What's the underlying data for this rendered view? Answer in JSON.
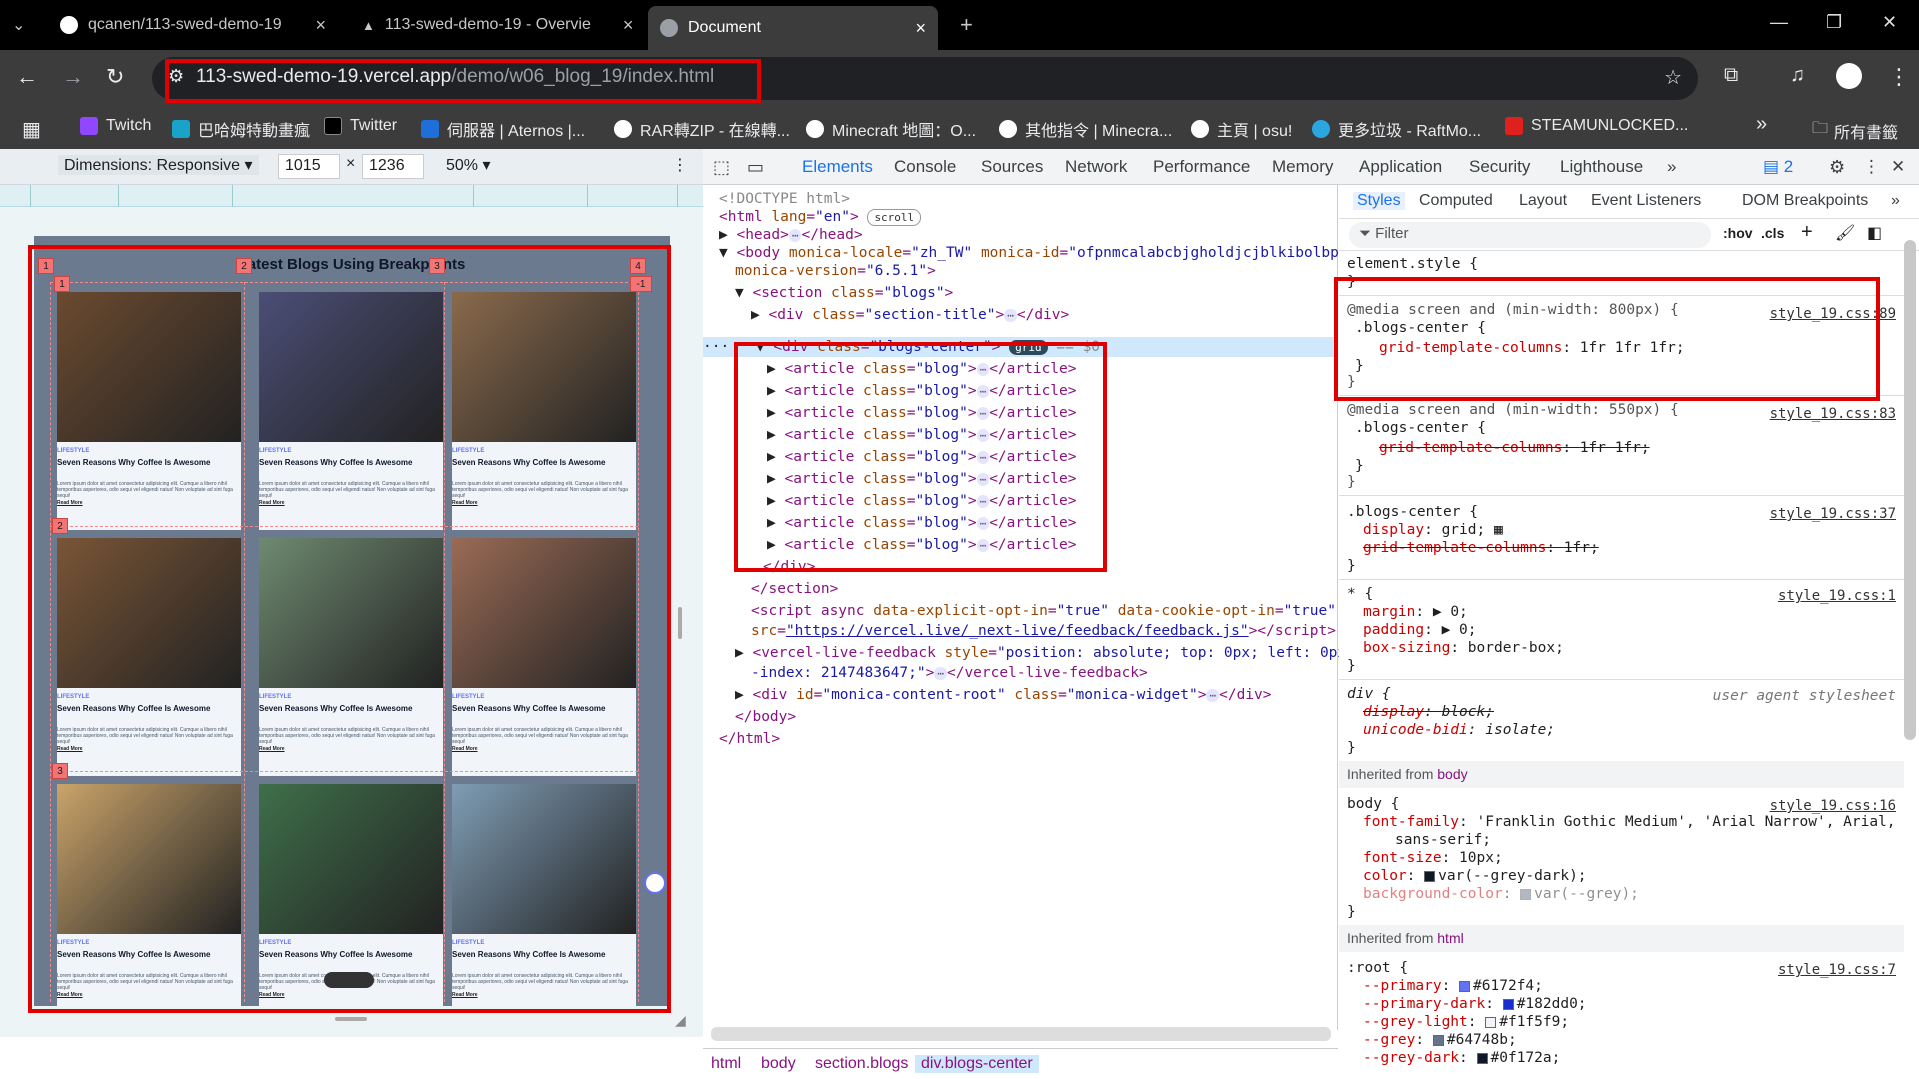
{
  "browser": {
    "tabs": [
      {
        "title": "qcanen/113-swed-demo-19",
        "close": "×"
      },
      {
        "title": "113-swed-demo-19 - Overvie",
        "close": "×"
      },
      {
        "title": "Document",
        "close": "×"
      }
    ],
    "new_tab": "+",
    "window_controls": {
      "minimize": "—",
      "restore": "❐",
      "close": "✕"
    },
    "url_host": "113-swed-demo-19.vercel.app",
    "url_path": "/demo/w06_blog_19/index.html",
    "bookmarks": [
      {
        "label": "Twitch",
        "color": "#9146ff"
      },
      {
        "label": "巴哈姆特動畫瘋",
        "color": "#1aa3c8"
      },
      {
        "label": "Twitter",
        "color": "#000000"
      },
      {
        "label": "伺服器 | Aternos |...",
        "color": "#1e6fd9"
      },
      {
        "label": "RAR轉ZIP - 在線轉...",
        "color": "#ffffff"
      },
      {
        "label": "Minecraft 地圖：O...",
        "color": "#ffffff"
      },
      {
        "label": "其他指令 | Minecra...",
        "color": "#ffffff"
      },
      {
        "label": "主頁 | osu!",
        "color": "#ffffff"
      },
      {
        "label": "更多垃圾 - RaftMo...",
        "color": "#2aa6e0"
      },
      {
        "label": "STEAMUNLOCKED...",
        "color": "#e0201c"
      }
    ],
    "bookmarks_more": "»",
    "all_bookmarks": "所有書籤"
  },
  "device_toolbar": {
    "dimensions": "Dimensions: Responsive ▾",
    "width": "1015",
    "times": "×",
    "height": "1236",
    "zoom": "50% ▾",
    "more": "⋮"
  },
  "preview": {
    "title": "Latest Blogs Using Breakpoints",
    "card": {
      "label": "LIFESTYLE",
      "heading": "Seven Reasons Why Coffee Is Awesome",
      "body": "Lorem ipsum dolor sit amet consectetur adipisicing elit. Cumque a libero nihil temporibus asperiores, odio sequi vel eligendi natus! Non voluptate ad sint fuga sequi!",
      "read_more": "Read More"
    },
    "grid_numbers": {
      "col1": "1",
      "col2": "2",
      "col3": "3",
      "col4": "4",
      "colneg": "-1",
      "row1": "1",
      "row2": "2",
      "row3": "3"
    }
  },
  "devtools": {
    "tabs": [
      "Elements",
      "Console",
      "Sources",
      "Network",
      "Performance",
      "Memory",
      "Application",
      "Security",
      "Lighthouse"
    ],
    "tabs_more": "»",
    "issues_count": "2",
    "dom": [
      "<!DOCTYPE html>",
      "html",
      "lang",
      "\"en\"",
      "scroll",
      "head",
      "body",
      "monica-locale",
      "\"zh_TW\"",
      "monica-id",
      "\"ofpnmcalabcbjgholdjcjblkibolbpppb\"",
      "monica-version",
      "\"6.5.1\"",
      "section",
      "class",
      "\"blogs\"",
      "div",
      "\"section-title\"",
      "\"blogs-center\"",
      "grid",
      "== $0",
      "article",
      "\"blog\"",
      "/div",
      "/section",
      "script async",
      "data-explicit-opt-in",
      "\"true\"",
      "data-cookie-opt-in",
      "\"true\"",
      "src",
      "\"https://vercel.live/_next-live/feedback/feedback.js\"",
      "vercel-live-feedback",
      "style",
      "\"position: absolute; top: 0px; left: 0px; z",
      "-index: 2147483647;\"",
      "\"monica-content-root\"",
      "\"monica-widget\"",
      "/body",
      "/html"
    ],
    "breadcrumbs": [
      "html",
      "body",
      "section.blogs",
      "div.blogs-center"
    ],
    "styles_tabs": [
      "Styles",
      "Computed",
      "Layout",
      "Event Listeners",
      "DOM Breakpoints"
    ],
    "filter_placeholder": "Filter",
    "filter_tools": [
      ":hov",
      ".cls",
      "+"
    ],
    "rules": {
      "element_style": "element.style {",
      "media1": "@media screen and (min-width: 800px) {",
      "media1_sel": ".blogs-center {",
      "media1_prop": "grid-template-columns",
      "media1_val": "1fr 1fr 1fr;",
      "media1_src": "style_19.css:89",
      "media2": "@media screen and (min-width: 550px) {",
      "media2_sel": ".blogs-center {",
      "media2_prop": "grid-template-columns",
      "media2_val": "1fr 1fr;",
      "media2_src": "style_19.css:83",
      "base_sel": ".blogs-center {",
      "base_display": "display",
      "base_display_val": "grid;",
      "base_gtc": "grid-template-columns",
      "base_gtc_val": "1fr;",
      "base_src": "style_19.css:37",
      "star_sel": "* {",
      "star_src": "style_19.css:1",
      "margin": "margin",
      "margin_val": "0;",
      "padding": "padding",
      "padding_val": "0;",
      "boxsizing": "box-sizing",
      "boxsizing_val": "border-box;",
      "div_sel": "div {",
      "ua": "user agent stylesheet",
      "ua_display": "display",
      "ua_display_val": "block;",
      "ua_unicode": "unicode-bidi",
      "ua_unicode_val": "isolate;",
      "inherited_body": "Inherited from",
      "inherited_body_tag": "body",
      "body_sel": "body {",
      "body_src": "style_19.css:16",
      "ff": "font-family",
      "ff_val": "'Franklin Gothic Medium', 'Arial Narrow', Arial,",
      "ff_val2": "sans-serif;",
      "fs": "font-size",
      "fs_val": "10px;",
      "color": "color",
      "color_val": "var(--grey-dark);",
      "bg": "background-color",
      "bg_val": "var(--grey);",
      "inherited_html_tag": "html",
      "root_sel": ":root {",
      "root_src": "style_19.css:7",
      "vars": [
        {
          "name": "--primary",
          "value": "#6172f4;",
          "swatch": "#6172f4"
        },
        {
          "name": "--primary-dark",
          "value": "#182dd0;",
          "swatch": "#182dd0"
        },
        {
          "name": "--grey-light",
          "value": "#f1f5f9;",
          "swatch": "#f1f5f9"
        },
        {
          "name": "--grey",
          "value": "#64748b;",
          "swatch": "#64748b"
        },
        {
          "name": "--grey-dark",
          "value": "#0f172a;",
          "swatch": "#0f172a"
        }
      ],
      "close_brace": "}"
    }
  },
  "colors": {
    "highlight_red": "#e00000",
    "accent_blue": "#1a73e8"
  }
}
